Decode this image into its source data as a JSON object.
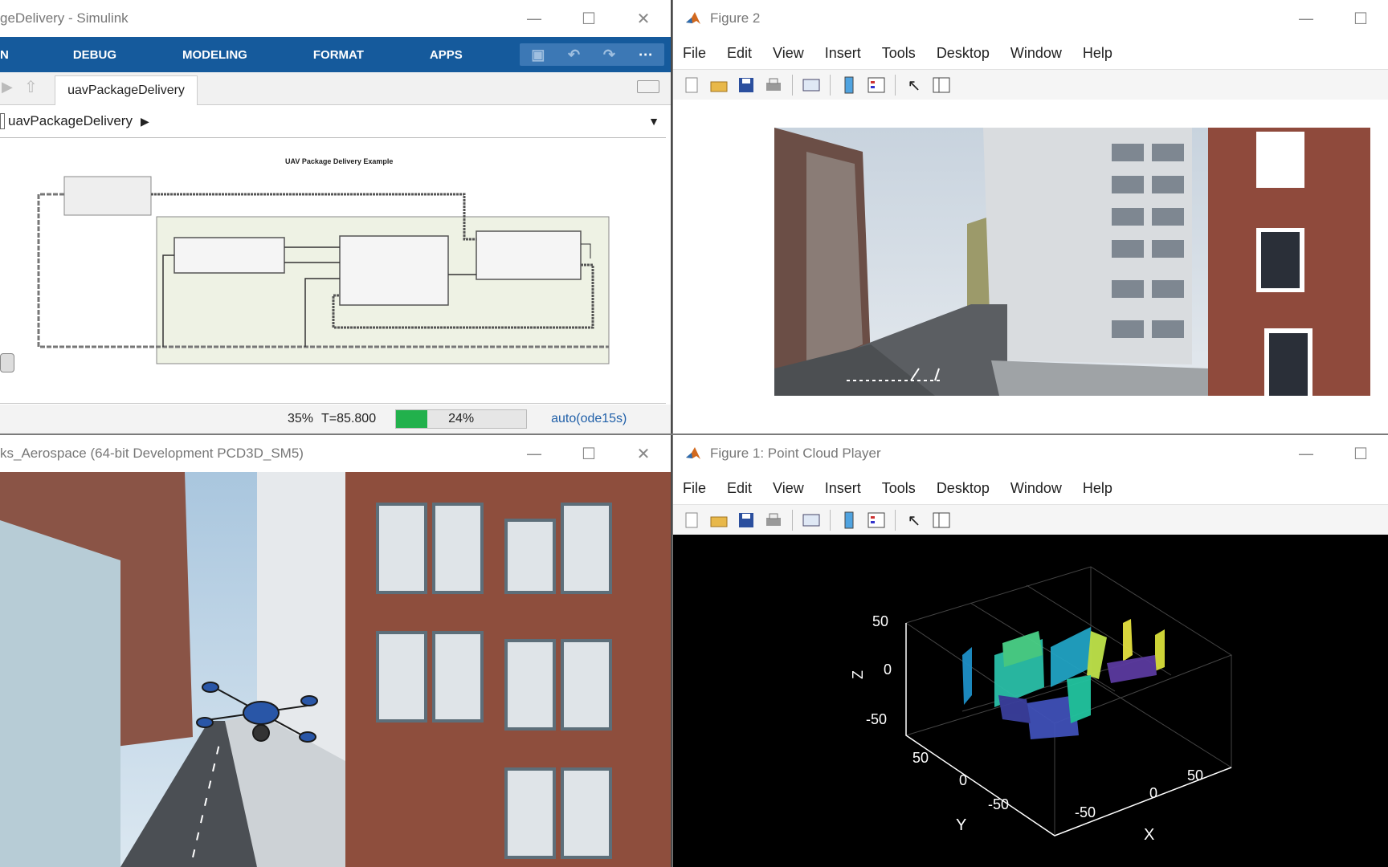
{
  "simulink": {
    "title": "geDelivery - Simulink",
    "ribbon_tabs": [
      "N",
      "DEBUG",
      "MODELING",
      "FORMAT",
      "APPS"
    ],
    "doc_tab": "uavPackageDelivery",
    "address": "uavPackageDelivery",
    "diagram_title": "UAV Package Delivery Example",
    "status": {
      "zoom": "35%",
      "time": "T=85.800",
      "progress": 0.24,
      "progress_label": "24%",
      "solver": "auto(ode15s)"
    }
  },
  "figure2": {
    "title": "Figure 2",
    "menu": [
      "File",
      "Edit",
      "View",
      "Insert",
      "Tools",
      "Desktop",
      "Window",
      "Help"
    ]
  },
  "aerospace": {
    "title": "ks_Aerospace (64-bit Development PCD3D_SM5)"
  },
  "point_cloud": {
    "title": "Figure 1: Point Cloud Player",
    "menu": [
      "File",
      "Edit",
      "View",
      "Insert",
      "Tools",
      "Desktop",
      "Window",
      "Help"
    ],
    "axes": {
      "z_label": "Z",
      "y_label": "Y",
      "x_label": "X",
      "z_ticks": [
        "50",
        "0",
        "-50"
      ],
      "y_ticks": [
        "50",
        "0",
        "-50"
      ],
      "x_ticks": [
        "-50",
        "0",
        "50"
      ]
    }
  },
  "colors": {
    "ribbon": "#155a9c",
    "progress": "#22b14c",
    "plot_bg": "#000000"
  }
}
